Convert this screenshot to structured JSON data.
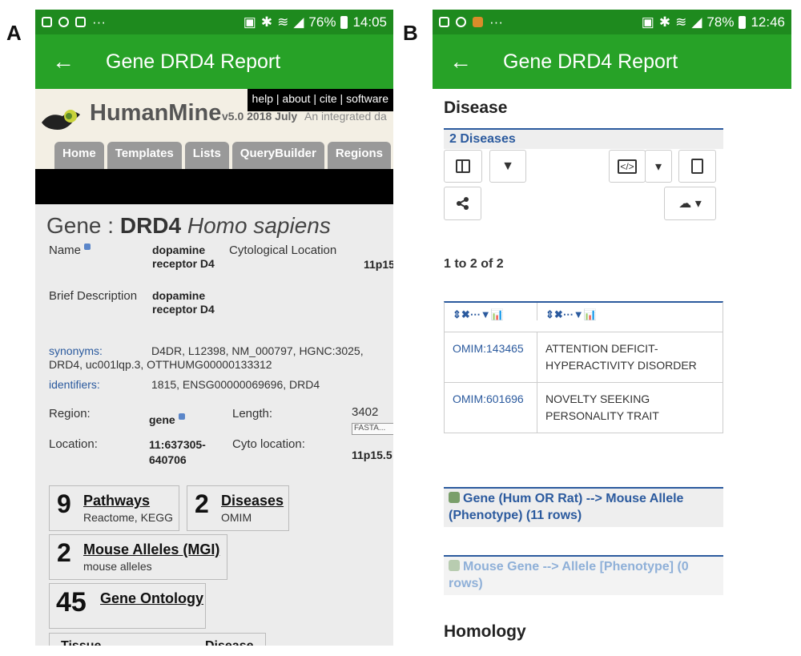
{
  "labels": {
    "a": "A",
    "b": "B"
  },
  "phone_a": {
    "status": {
      "battery": "76%",
      "time": "14:05",
      "overflow": "···"
    },
    "appbar": {
      "title": "Gene DRD4 Report",
      "back": "←"
    },
    "humanmine": {
      "toplinks": "help  | about  | cite  | software",
      "name": "HumanMine",
      "version": "v5.0 2018 July",
      "tagline": "An integrated da",
      "nav": [
        "Home",
        "Templates",
        "Lists",
        "QueryBuilder",
        "Regions"
      ]
    },
    "gene": {
      "prefix": "Gene : ",
      "symbol": "DRD4",
      "organism": "Homo sapiens",
      "name_label": "Name",
      "name_value": "dopamine receptor D4",
      "cyto_label": "Cytological Location",
      "cyto_value": "11p15",
      "brief_label": "Brief Description",
      "brief_value": "dopamine receptor D4",
      "synonyms_label": "synonyms:",
      "synonyms_value": "D4DR, L12398, NM_000797, HGNC:3025,",
      "synonyms_value2": "DRD4, uc001lqp.3, OTTHUMG00000133312",
      "identifiers_label": "identifiers:",
      "identifiers_value": "1815, ENSG00000069696, DRD4",
      "region_label": "Region:",
      "region_value": "gene",
      "length_label": "Length:",
      "length_value": "3402",
      "fasta": "FASTA...",
      "location_label": "Location:",
      "location_value": "11:637305-640706",
      "cytoloc_label": "Cyto location:",
      "cytoloc_value": "11p15.5"
    },
    "summary": [
      {
        "count": "9",
        "title": "Pathways",
        "sub": "Reactome, KEGG"
      },
      {
        "count": "2",
        "title": "Diseases",
        "sub": "OMIM"
      },
      {
        "count": "2",
        "title": "Mouse Alleles (MGI)",
        "sub": "mouse alleles"
      },
      {
        "count": "45",
        "title": "Gene Ontology",
        "sub": ""
      }
    ],
    "bottom_tabs": [
      "Tissue",
      "Disease"
    ]
  },
  "phone_b": {
    "status": {
      "battery": "78%",
      "time": "12:46",
      "overflow": "···"
    },
    "appbar": {
      "title": "Gene DRD4 Report",
      "back": "←"
    },
    "disease_heading": "Disease",
    "diseases_count": "2 Diseases",
    "range": "1 to 2 of 2",
    "table_header_icons": "⇕✖⋯▼📊",
    "rows": [
      {
        "id": "OMIM:143465",
        "name": "ATTENTION DEFICIT-HYPERACTIVITY DISORDER"
      },
      {
        "id": "OMIM:601696",
        "name": "NOVELTY SEEKING PERSONALITY TRAIT"
      }
    ],
    "template1": "Gene (Hum OR Rat) --> Mouse Allele (Phenotype)   (11 rows)",
    "template2": "Mouse Gene --> Allele [Phenotype]   (0 rows)",
    "homology_heading": "Homology"
  },
  "colors": {
    "status_green": "#1e8a1e",
    "appbar_green": "#27a227",
    "link_blue": "#2b5a9e"
  }
}
